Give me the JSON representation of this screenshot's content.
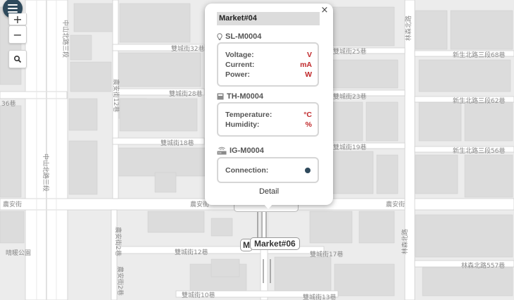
{
  "map": {
    "road_labels": {
      "top_left_lane": "雙城街32巷",
      "mid_left_lane": "雙城街28巷",
      "lower_left_lane": "雙城街18巷",
      "right_lane_25": "雙城街25巷",
      "right_lane_23": "雙城街23巷",
      "right_lane_19": "雙城街19巷",
      "far_right_68": "新生北路三段68巷",
      "far_right_62": "新生北路三段62巷",
      "far_right_56": "新生北路三段56巷",
      "lane_36": "36巷",
      "zhongshan_top": "中山北路三段",
      "zhongshan_mid": "中山北路三段",
      "nongan_left": "農安街",
      "nongan_mid": "農安街",
      "nongan_right": "農安街",
      "shuangcheng_12": "雙城街12巷",
      "shuangcheng_17": "雙城街17巷",
      "shuangcheng_10": "雙城街10巷",
      "shuangcheng_13": "雙城街13巷",
      "linsen_top": "林森北路",
      "linsen_bottom": "林森北路",
      "linsen_557": "林森北路557巷",
      "nongan_lane2": "農安街2巷",
      "nongan_lane2_branch": "農安街2巷",
      "nongan_12": "農安街12巷",
      "park": "晴暖公園"
    },
    "markers": {
      "market06_label": "Market#06",
      "market06_partial": "M"
    }
  },
  "controls": {
    "zoom_in": "+",
    "zoom_out": "−",
    "search_icon": "search-icon",
    "menu_icon": "menu-icon"
  },
  "popup": {
    "title": "Market#04",
    "close": "×",
    "devices": {
      "sl": {
        "id": "SL-M0004",
        "icon": "streetlight-icon",
        "rows": [
          {
            "label": "Voltage:",
            "unit": "V"
          },
          {
            "label": "Current:",
            "unit": "mA"
          },
          {
            "label": "Power:",
            "unit": "W"
          }
        ]
      },
      "th": {
        "id": "TH-M0004",
        "icon": "sensor-icon",
        "rows": [
          {
            "label": "Temperature:",
            "unit": "°C"
          },
          {
            "label": "Humidity:",
            "unit": "%"
          }
        ]
      },
      "ig": {
        "id": "IG-M0004",
        "icon": "gateway-icon",
        "rows": [
          {
            "label": "Connection:"
          }
        ]
      }
    },
    "detail_link": "Detail"
  },
  "colors": {
    "accent": "#2f4a5c",
    "unit_red": "#c0282a",
    "map_bg": "#ececec",
    "building": "#dcdcdc"
  }
}
